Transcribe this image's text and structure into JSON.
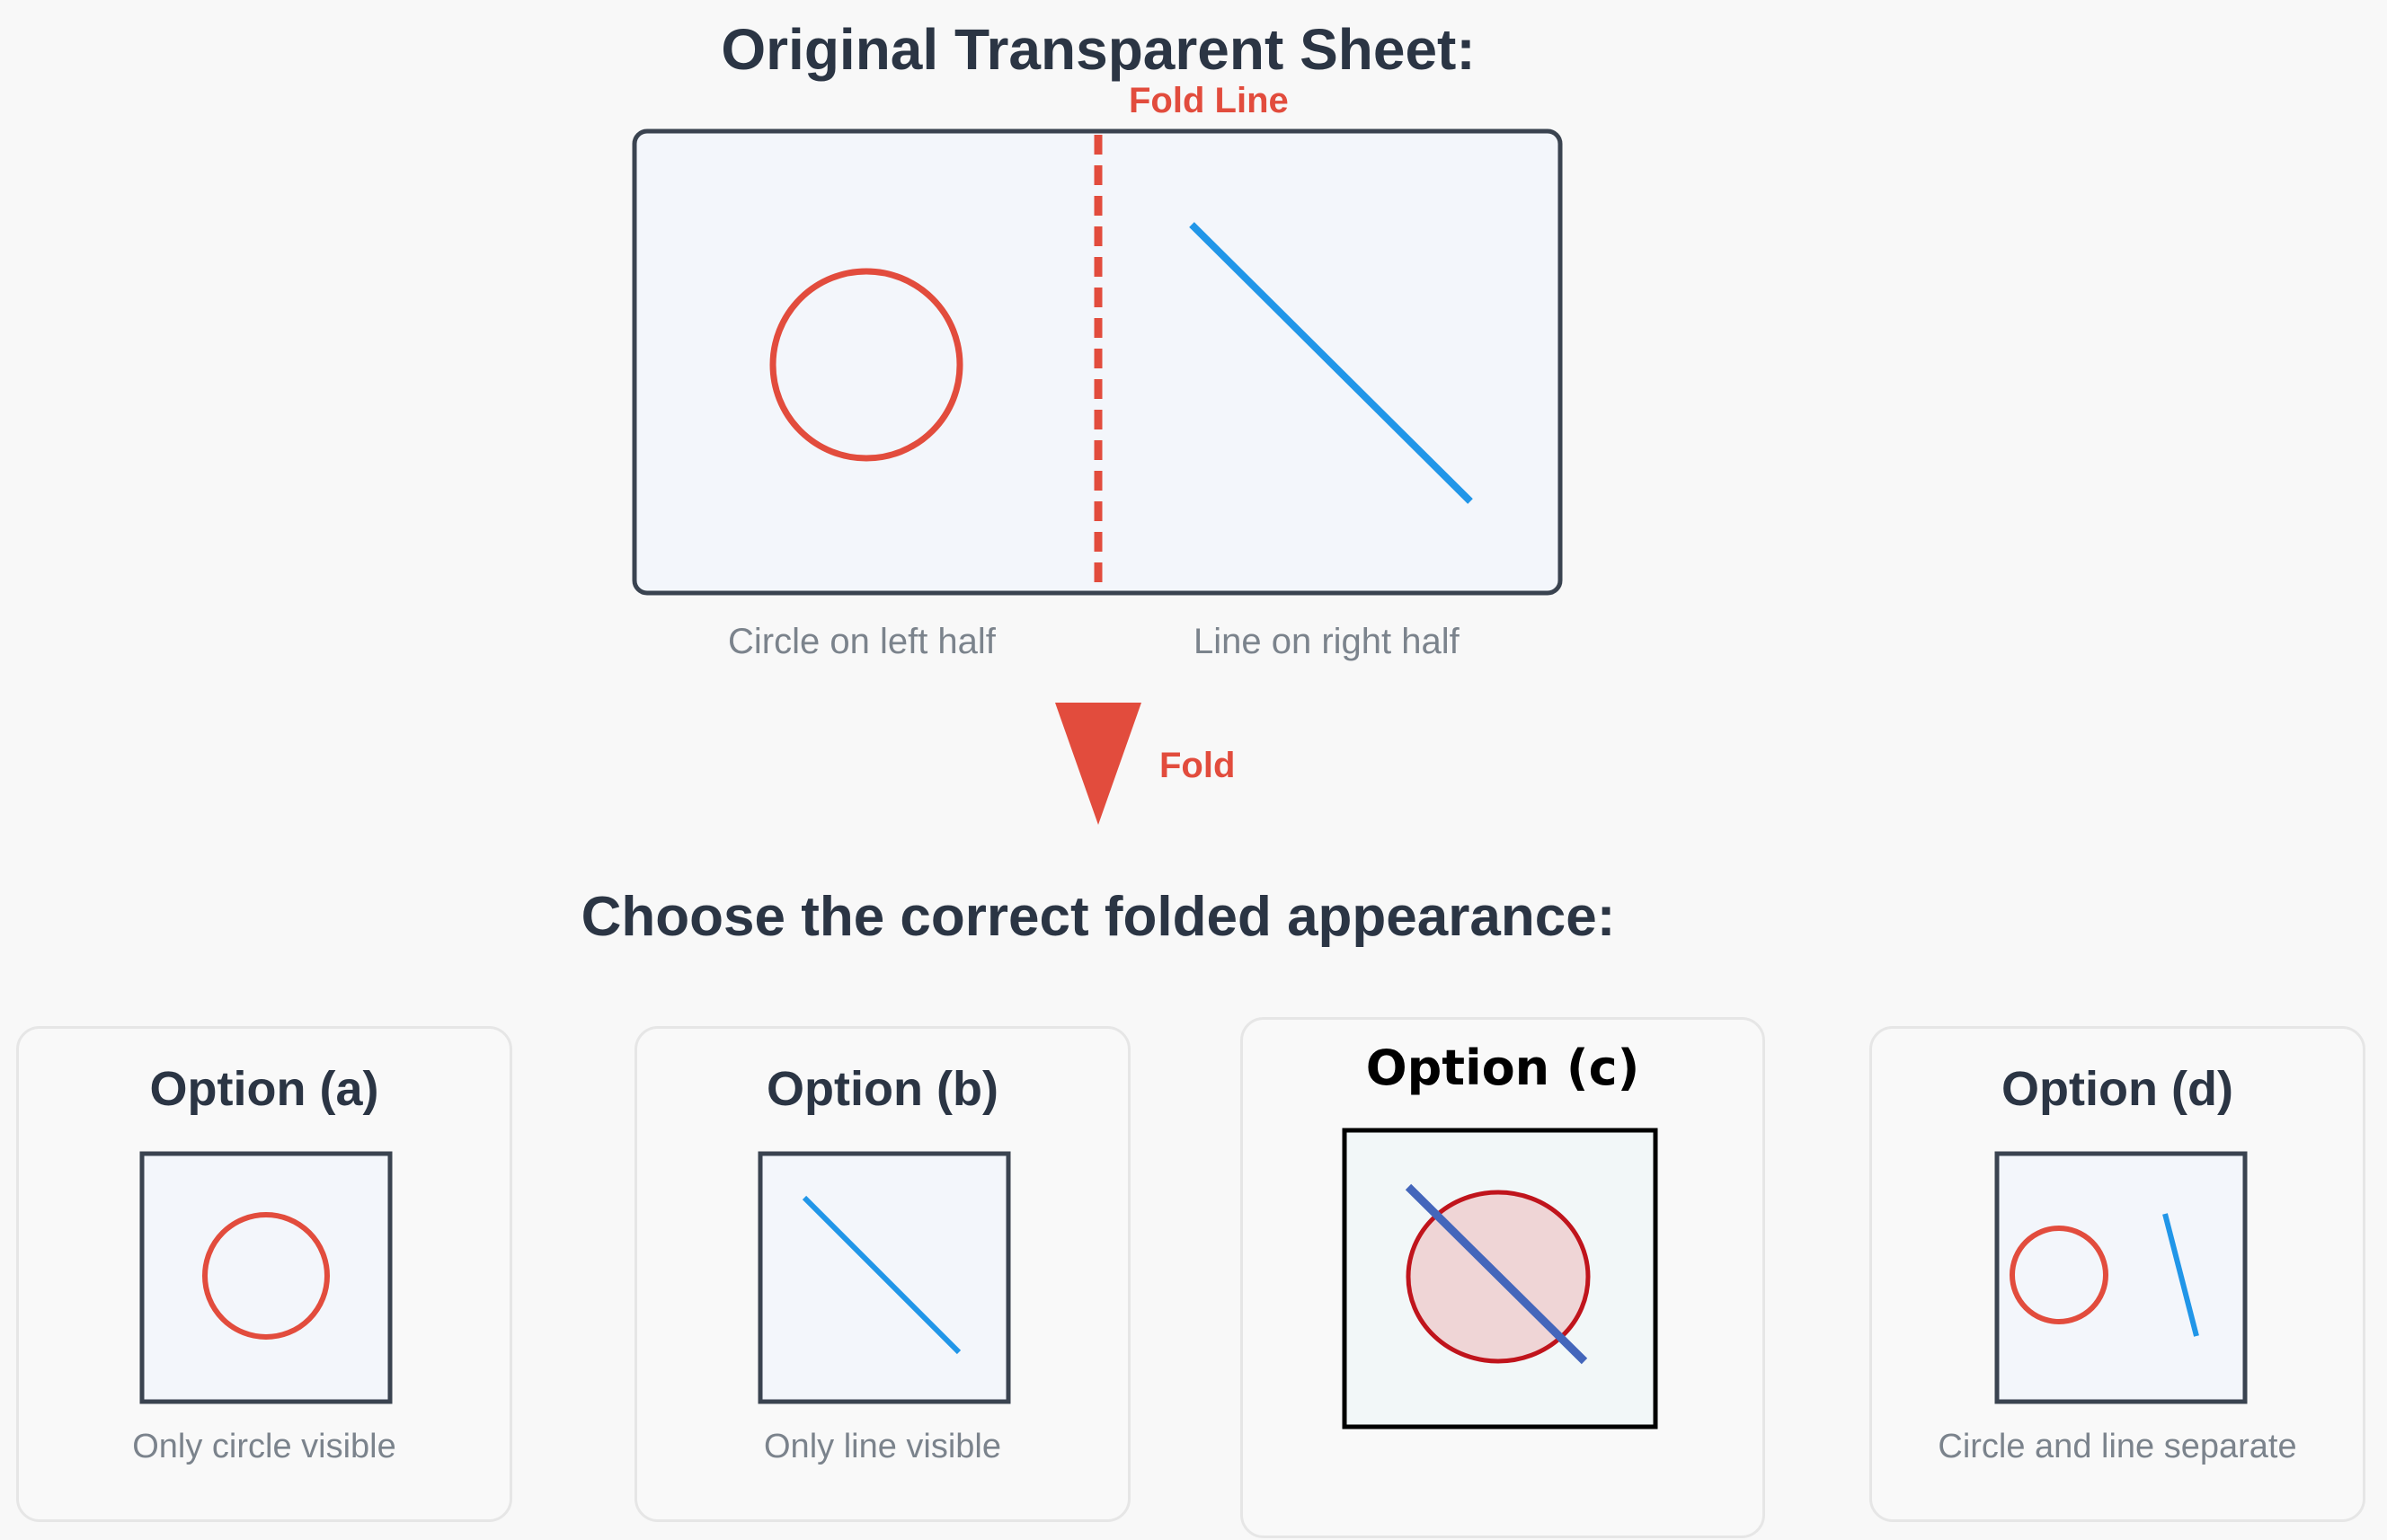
{
  "header": {
    "title": "Original Transparent Sheet:",
    "fold_line_label": "Fold Line"
  },
  "sheet": {
    "left_caption": "Circle on left half",
    "right_caption": "Line on right half"
  },
  "fold": {
    "label": "Fold"
  },
  "question": "Choose the correct folded appearance:",
  "options": [
    {
      "title": "Option (a)",
      "caption": "Only circle visible"
    },
    {
      "title": "Option (b)",
      "caption": "Only line visible"
    },
    {
      "title": "Option (c)",
      "caption": ""
    },
    {
      "title": "Option (d)",
      "caption": "Circle and line separate"
    }
  ],
  "colors": {
    "circle_red": "#e24c3d",
    "line_blue": "#2196e8",
    "frame_dark": "#3a4350",
    "fill_pale": "#f3f6fb",
    "option_c_line": "#4466bb",
    "option_c_circle_fill": "#efd5d6",
    "option_c_circle_stroke": "#c0141c"
  }
}
